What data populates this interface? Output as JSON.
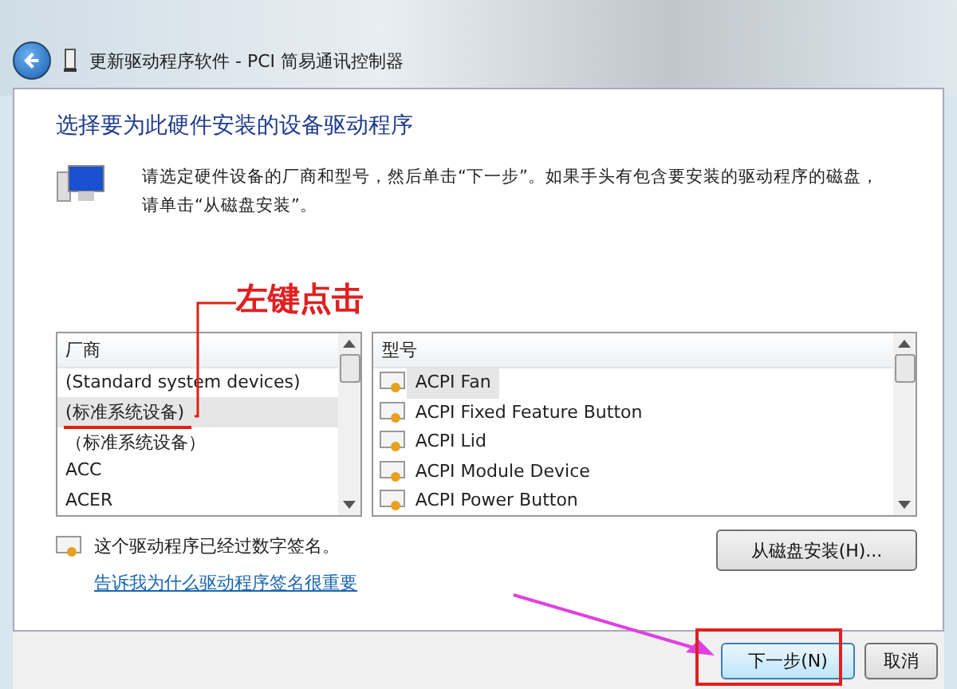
{
  "window": {
    "title": "更新驱动程序软件 - PCI 简易通讯控制器"
  },
  "heading": "选择要为此硬件安装的设备驱动程序",
  "description": "请选定硬件设备的厂商和型号，然后单击“下一步”。如果手头有包含要安装的驱动程序的磁盘，请单击“从磁盘安装”。",
  "manufacturer_list": {
    "header": "厂商",
    "items": [
      {
        "label": "(Standard system devices)",
        "selected": false
      },
      {
        "label": "(标准系统设备)",
        "selected": true
      },
      {
        "label": "（标准系统设备）",
        "selected": false
      },
      {
        "label": "ACC",
        "selected": false
      },
      {
        "label": "ACER",
        "selected": false
      }
    ]
  },
  "model_list": {
    "header": "型号",
    "items": [
      {
        "label": "ACPI Fan",
        "selected": true
      },
      {
        "label": "ACPI Fixed Feature Button",
        "selected": false
      },
      {
        "label": "ACPI Lid",
        "selected": false
      },
      {
        "label": "ACPI Module Device",
        "selected": false
      },
      {
        "label": "ACPI Power Button",
        "selected": false
      }
    ]
  },
  "signature_note": "这个驱动程序已经过数字签名。",
  "signature_link": "告诉我为什么驱动程序签名很重要",
  "have_disk_button": "从磁盘安装(H)...",
  "buttons": [
    {
      "label": "下一步(N)",
      "kind": "primary"
    },
    {
      "label": "取消",
      "kind": "secondary"
    }
  ],
  "annotation": {
    "label": "左键点击"
  }
}
